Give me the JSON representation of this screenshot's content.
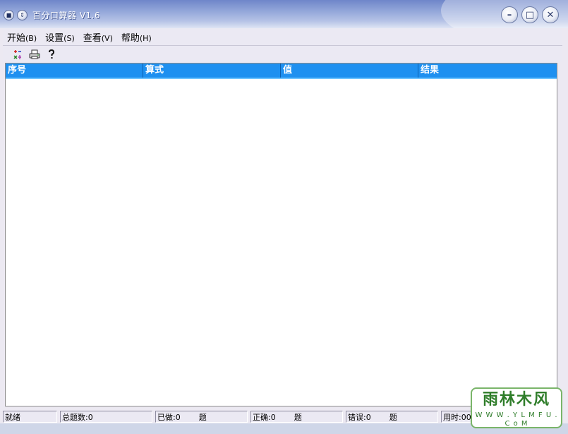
{
  "window": {
    "title": "百分口算器 V1.6",
    "system_menu_icon": "square-dot-icon",
    "rollup_icon": "chevron-updown-icon",
    "controls": {
      "minimize": "minimize-icon",
      "maximize": "maximize-icon",
      "close": "close-icon"
    }
  },
  "menu": [
    {
      "label": "开始",
      "mnemonic": "(B)"
    },
    {
      "label": "设置",
      "mnemonic": "(S)"
    },
    {
      "label": "查看",
      "mnemonic": "(V)"
    },
    {
      "label": "帮助",
      "mnemonic": "(H)"
    }
  ],
  "toolbar": {
    "buttons": [
      "arithmetic-icon",
      "printer-icon",
      "help-icon"
    ]
  },
  "list": {
    "columns": [
      "序号",
      "算式",
      "值",
      "结果"
    ],
    "rows": []
  },
  "status": {
    "ready": "就绪",
    "total": "总题数:0",
    "done": "已做:0",
    "done_unit": "题",
    "correct": "正确:0",
    "correct_unit": "题",
    "wrong": "错误:0",
    "wrong_unit": "题",
    "time": "用时:00"
  },
  "watermark": {
    "main": "雨林木风",
    "sub": "W W W . Y L M F U . C o M"
  },
  "colors": {
    "header_bg": "#1e90f0",
    "titlebar_start": "#6f86c9",
    "watermark_green": "#2f7d2a"
  }
}
